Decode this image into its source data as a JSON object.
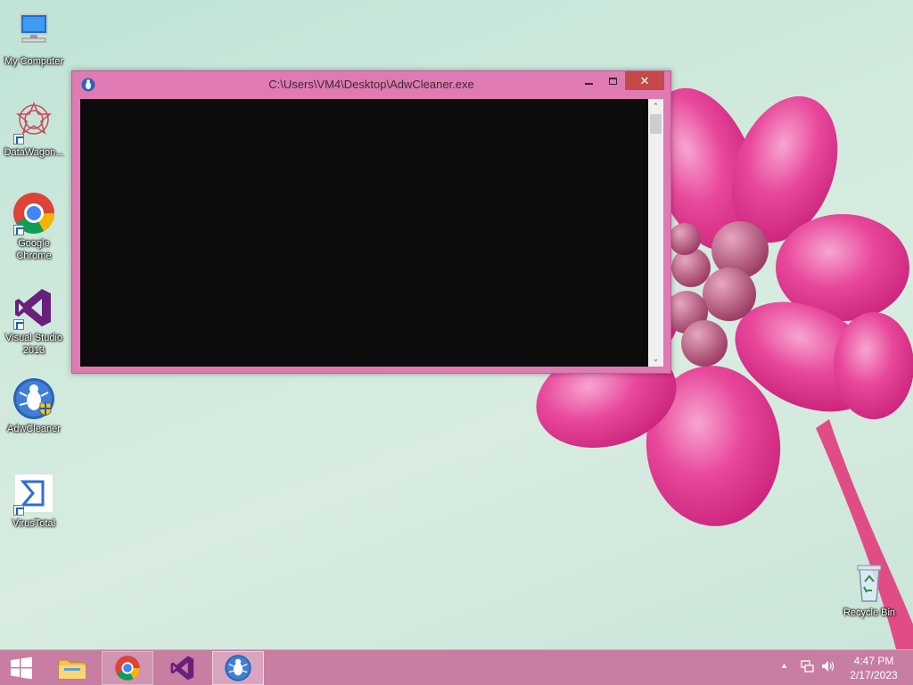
{
  "desktop": {
    "icons": [
      {
        "label": "My Computer",
        "icon": "computer-icon"
      },
      {
        "label": "DataWagon...",
        "icon": "datawagon-icon"
      },
      {
        "label": "Google Chrome",
        "icon": "chrome-icon"
      },
      {
        "label": "Visual Studio 2013",
        "icon": "visual-studio-icon"
      },
      {
        "label": "AdwCleaner",
        "icon": "adwcleaner-icon"
      },
      {
        "label": "VirusTotal",
        "icon": "virustotal-icon"
      },
      {
        "label": "Recycle Bin",
        "icon": "recycle-bin-icon"
      }
    ]
  },
  "console": {
    "title": "C:\\Users\\VM4\\Desktop\\AdwCleaner.exe",
    "close_glyph": "✕",
    "scroll_up_glyph": "⌃",
    "scroll_down_glyph": "⌄"
  },
  "taskbar": {
    "apps": [
      {
        "name": "File Explorer",
        "icon": "folder-icon"
      },
      {
        "name": "Google Chrome",
        "icon": "chrome-icon"
      },
      {
        "name": "Visual Studio 2013",
        "icon": "visual-studio-icon"
      },
      {
        "name": "AdwCleaner",
        "icon": "adwcleaner-icon",
        "active": true
      }
    ],
    "tray_chevron": "▲",
    "time": "4:47 PM",
    "date": "2/17/2023"
  },
  "colors": {
    "window_border": "#e07ab2",
    "close_button": "#c74848",
    "taskbar": "#c87da3",
    "console_bg": "#0c0c0c"
  }
}
